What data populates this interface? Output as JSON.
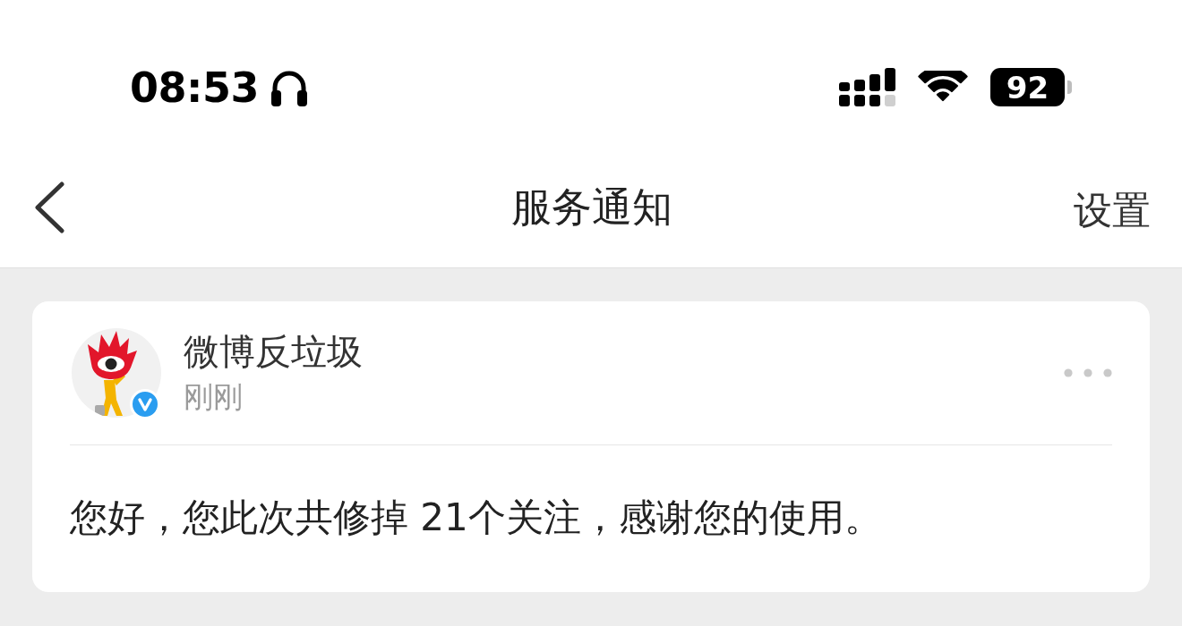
{
  "status_bar": {
    "time": "08:53",
    "battery": "92"
  },
  "nav_bar": {
    "title": "服务通知",
    "action": "设置"
  },
  "notifications": [
    {
      "sender": "微博反垃圾",
      "verified": true,
      "time": "刚刚",
      "message": "您好，您此次共修掉 21个关注，感谢您的使用。"
    }
  ]
}
